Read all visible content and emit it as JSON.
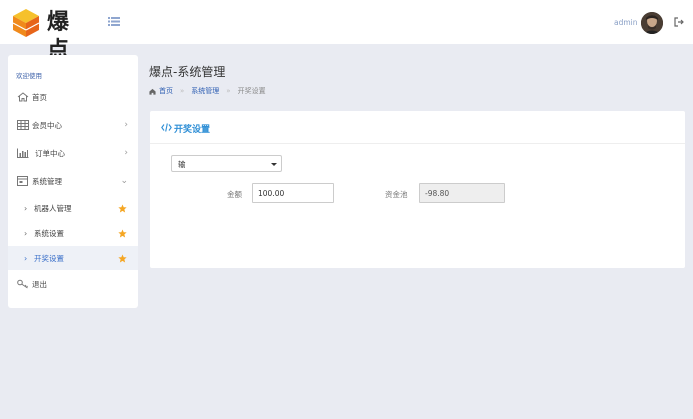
{
  "header": {
    "logo_text": "爆点",
    "user_name": "admin"
  },
  "sidebar": {
    "welcome": "欢迎使用",
    "items": [
      {
        "label": "首页"
      },
      {
        "label": "会员中心"
      },
      {
        "label": "订单中心"
      },
      {
        "label": "系统管理"
      },
      {
        "label": "机器人管理"
      },
      {
        "label": "系统设置"
      },
      {
        "label": "开奖设置"
      },
      {
        "label": "退出"
      }
    ]
  },
  "main": {
    "page_title": "爆点-系统管理",
    "breadcrumb": [
      "首页",
      "系统管理",
      "开奖设置"
    ],
    "card": {
      "title": "开奖设置",
      "select_value": "输",
      "amount_label": "金额",
      "amount_value": "100.00",
      "pool_label": "资金池",
      "pool_value": "-98.80"
    }
  },
  "colors": {
    "accent": "#2f8fd6",
    "link": "#2f5fb3",
    "star": "#f5a623",
    "background": "#e9ebf2"
  }
}
